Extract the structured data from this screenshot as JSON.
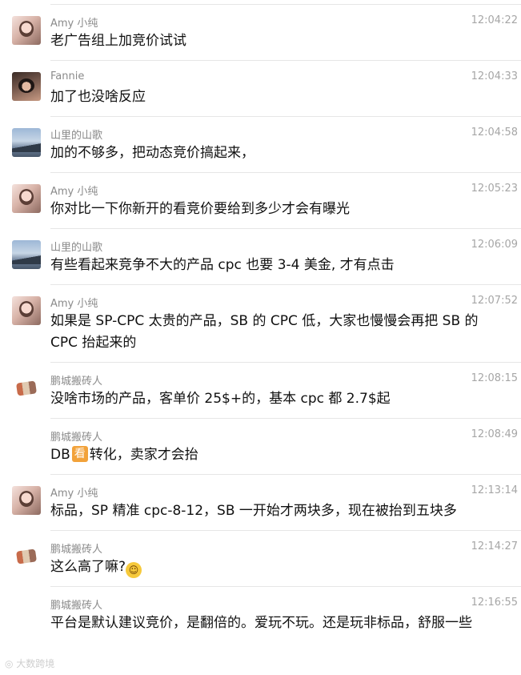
{
  "messages": [
    {
      "sender": "Amy 小纯",
      "time": "12:04:22",
      "text": "老广告组上加竞价试试",
      "avatar": "amy-avatar"
    },
    {
      "sender": "Fannie",
      "time": "12:04:33",
      "text": "加了也没啥反应",
      "avatar": "fannie-avatar"
    },
    {
      "sender": "山里的山歌",
      "time": "12:04:58",
      "text": "加的不够多，把动态竞价搞起来，",
      "avatar": "shange-avatar"
    },
    {
      "sender": "Amy 小纯",
      "time": "12:05:23",
      "text": "你对比一下你新开的看竞价要给到多少才会有曝光",
      "avatar": "amy-avatar"
    },
    {
      "sender": "山里的山歌",
      "time": "12:06:09",
      "text": "有些看起来竞争不大的产品 cpc 也要 3-4 美金, 才有点击",
      "avatar": "shange-avatar"
    },
    {
      "sender": "Amy 小纯",
      "time": "12:07:52",
      "text": "如果是 SP-CPC 太贵的产品，SB 的 CPC 低，大家也慢慢会再把 SB 的 CPC 抬起来的",
      "avatar": "amy-avatar"
    },
    {
      "sender": "鹏城搬砖人",
      "time": "12:08:15",
      "text": "没啥市场的产品，客单价 25$+的，基本 cpc 都 2.7$起",
      "avatar": "pengcheng-avatar"
    },
    {
      "sender": "鹏城搬砖人",
      "time": "12:08:49",
      "text_before": "DB",
      "badge": "看",
      "text_after": "转化，卖家才会抬",
      "avatar": ""
    },
    {
      "sender": "Amy 小纯",
      "time": "12:13:14",
      "text": "标品，SP 精准 cpc-8-12，SB 一开始才两块多，现在被抬到五块多",
      "avatar": "amy-avatar"
    },
    {
      "sender": "鹏城搬砖人",
      "time": "12:14:27",
      "text": "这么高了嘛?",
      "emoji": "grin",
      "avatar": "pengcheng-avatar"
    },
    {
      "sender": "鹏城搬砖人",
      "time": "12:16:55",
      "text": "平台是默认建议竞价，是翻倍的。爱玩不玩。还是玩非标品，舒服一些",
      "avatar": ""
    }
  ],
  "watermark": "大数跨境"
}
